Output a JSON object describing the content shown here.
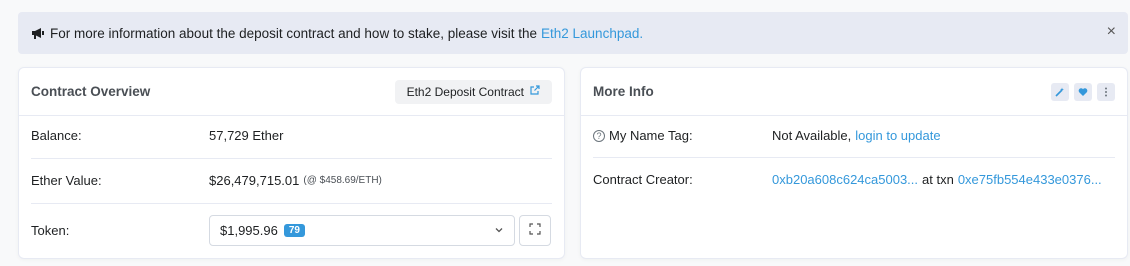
{
  "alert": {
    "text": "For more information about the deposit contract and how to stake, please visit the",
    "link": "Eth2 Launchpad.",
    "close": "×",
    "icon": "megaphone-icon"
  },
  "overview": {
    "title": "Contract Overview",
    "tag_button": "Eth2 Deposit Contract",
    "balance_label": "Balance:",
    "balance_value": "57,729 Ether",
    "ether_value_label": "Ether Value:",
    "ether_value": "$26,479,715.01",
    "ether_price": "(@ $458.69/ETH)",
    "token_label": "Token:",
    "token_value": "$1,995.96",
    "token_count": "79"
  },
  "more_info": {
    "title": "More Info",
    "name_tag_label": "My Name Tag:",
    "name_tag_value": "Not Available,",
    "name_tag_link": "login to update",
    "creator_label": "Contract Creator:",
    "creator_address": "0xb20a608c624ca5003...",
    "creator_at": "at txn",
    "creator_txn": "0xe75fb554e433e0376..."
  },
  "colors": {
    "accent": "#3498db",
    "alert_bg": "#e7eaf3",
    "border": "#e7eaf3"
  }
}
